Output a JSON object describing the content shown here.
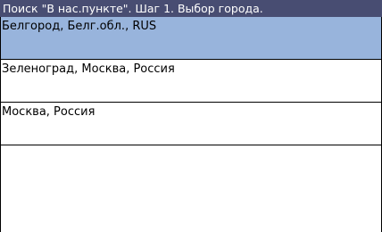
{
  "header": {
    "title": "Поиск \"В нас.пункте\". Шаг 1. Выбор города."
  },
  "city_list": {
    "items": [
      {
        "label": "Белгород, Белг.обл., RUS",
        "selected": true
      },
      {
        "label": "Зеленоград, Москва, Россия",
        "selected": false
      },
      {
        "label": "Москва, Россия",
        "selected": false
      }
    ]
  },
  "colors": {
    "title_bar": "#484d72",
    "selected_row": "#98b4dc",
    "row_border": "#000000"
  }
}
